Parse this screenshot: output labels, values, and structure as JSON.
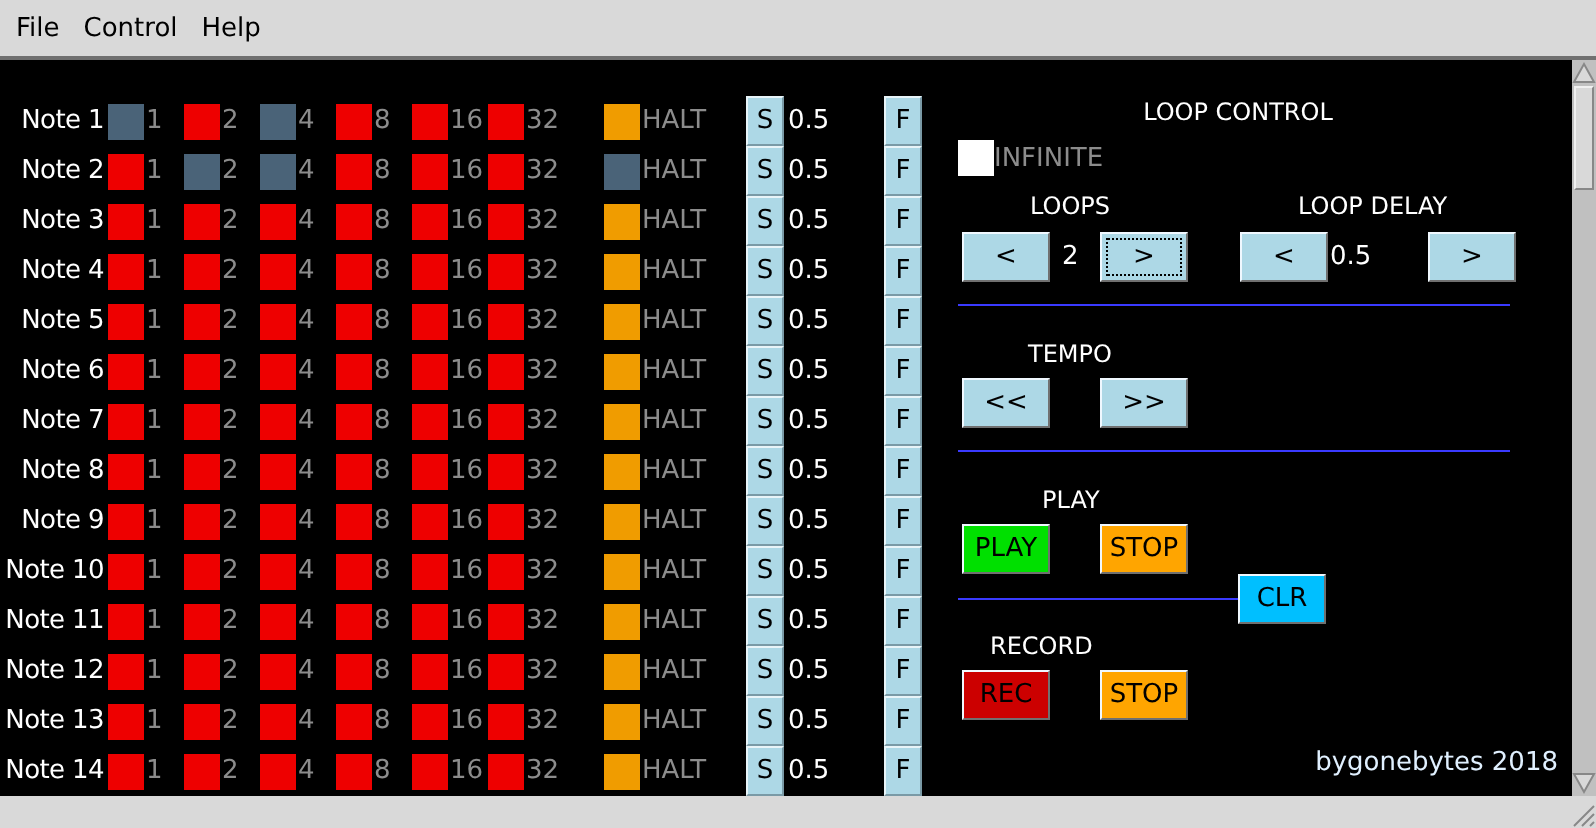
{
  "menu": [
    {
      "label": "File"
    },
    {
      "label": "Control"
    },
    {
      "label": "Help"
    }
  ],
  "notes": [
    {
      "label": "Note 1",
      "beats": [
        {
          "label": "1",
          "on": false
        },
        {
          "label": "2",
          "on": true
        },
        {
          "label": "4",
          "on": false
        },
        {
          "label": "8",
          "on": true
        },
        {
          "label": "16",
          "on": true
        },
        {
          "label": "32",
          "on": true
        }
      ],
      "halt": {
        "label": "HALT",
        "on": true
      },
      "s": "S",
      "value": "0.5",
      "f": "F"
    },
    {
      "label": "Note 2",
      "beats": [
        {
          "label": "1",
          "on": true
        },
        {
          "label": "2",
          "on": false
        },
        {
          "label": "4",
          "on": false
        },
        {
          "label": "8",
          "on": true
        },
        {
          "label": "16",
          "on": true
        },
        {
          "label": "32",
          "on": true
        }
      ],
      "halt": {
        "label": "HALT",
        "on": false
      },
      "s": "S",
      "value": "0.5",
      "f": "F"
    },
    {
      "label": "Note 3",
      "beats": [
        {
          "label": "1",
          "on": true
        },
        {
          "label": "2",
          "on": true
        },
        {
          "label": "4",
          "on": true
        },
        {
          "label": "8",
          "on": true
        },
        {
          "label": "16",
          "on": true
        },
        {
          "label": "32",
          "on": true
        }
      ],
      "halt": {
        "label": "HALT",
        "on": true
      },
      "s": "S",
      "value": "0.5",
      "f": "F"
    },
    {
      "label": "Note 4",
      "beats": [
        {
          "label": "1",
          "on": true
        },
        {
          "label": "2",
          "on": true
        },
        {
          "label": "4",
          "on": true
        },
        {
          "label": "8",
          "on": true
        },
        {
          "label": "16",
          "on": true
        },
        {
          "label": "32",
          "on": true
        }
      ],
      "halt": {
        "label": "HALT",
        "on": true
      },
      "s": "S",
      "value": "0.5",
      "f": "F"
    },
    {
      "label": "Note 5",
      "beats": [
        {
          "label": "1",
          "on": true
        },
        {
          "label": "2",
          "on": true
        },
        {
          "label": "4",
          "on": true
        },
        {
          "label": "8",
          "on": true
        },
        {
          "label": "16",
          "on": true
        },
        {
          "label": "32",
          "on": true
        }
      ],
      "halt": {
        "label": "HALT",
        "on": true
      },
      "s": "S",
      "value": "0.5",
      "f": "F"
    },
    {
      "label": "Note 6",
      "beats": [
        {
          "label": "1",
          "on": true
        },
        {
          "label": "2",
          "on": true
        },
        {
          "label": "4",
          "on": true
        },
        {
          "label": "8",
          "on": true
        },
        {
          "label": "16",
          "on": true
        },
        {
          "label": "32",
          "on": true
        }
      ],
      "halt": {
        "label": "HALT",
        "on": true
      },
      "s": "S",
      "value": "0.5",
      "f": "F"
    },
    {
      "label": "Note 7",
      "beats": [
        {
          "label": "1",
          "on": true
        },
        {
          "label": "2",
          "on": true
        },
        {
          "label": "4",
          "on": true
        },
        {
          "label": "8",
          "on": true
        },
        {
          "label": "16",
          "on": true
        },
        {
          "label": "32",
          "on": true
        }
      ],
      "halt": {
        "label": "HALT",
        "on": true
      },
      "s": "S",
      "value": "0.5",
      "f": "F"
    },
    {
      "label": "Note 8",
      "beats": [
        {
          "label": "1",
          "on": true
        },
        {
          "label": "2",
          "on": true
        },
        {
          "label": "4",
          "on": true
        },
        {
          "label": "8",
          "on": true
        },
        {
          "label": "16",
          "on": true
        },
        {
          "label": "32",
          "on": true
        }
      ],
      "halt": {
        "label": "HALT",
        "on": true
      },
      "s": "S",
      "value": "0.5",
      "f": "F"
    },
    {
      "label": "Note 9",
      "beats": [
        {
          "label": "1",
          "on": true
        },
        {
          "label": "2",
          "on": true
        },
        {
          "label": "4",
          "on": true
        },
        {
          "label": "8",
          "on": true
        },
        {
          "label": "16",
          "on": true
        },
        {
          "label": "32",
          "on": true
        }
      ],
      "halt": {
        "label": "HALT",
        "on": true
      },
      "s": "S",
      "value": "0.5",
      "f": "F"
    },
    {
      "label": "Note 10",
      "beats": [
        {
          "label": "1",
          "on": true
        },
        {
          "label": "2",
          "on": true
        },
        {
          "label": "4",
          "on": true
        },
        {
          "label": "8",
          "on": true
        },
        {
          "label": "16",
          "on": true
        },
        {
          "label": "32",
          "on": true
        }
      ],
      "halt": {
        "label": "HALT",
        "on": true
      },
      "s": "S",
      "value": "0.5",
      "f": "F"
    },
    {
      "label": "Note 11",
      "beats": [
        {
          "label": "1",
          "on": true
        },
        {
          "label": "2",
          "on": true
        },
        {
          "label": "4",
          "on": true
        },
        {
          "label": "8",
          "on": true
        },
        {
          "label": "16",
          "on": true
        },
        {
          "label": "32",
          "on": true
        }
      ],
      "halt": {
        "label": "HALT",
        "on": true
      },
      "s": "S",
      "value": "0.5",
      "f": "F"
    },
    {
      "label": "Note 12",
      "beats": [
        {
          "label": "1",
          "on": true
        },
        {
          "label": "2",
          "on": true
        },
        {
          "label": "4",
          "on": true
        },
        {
          "label": "8",
          "on": true
        },
        {
          "label": "16",
          "on": true
        },
        {
          "label": "32",
          "on": true
        }
      ],
      "halt": {
        "label": "HALT",
        "on": true
      },
      "s": "S",
      "value": "0.5",
      "f": "F"
    },
    {
      "label": "Note 13",
      "beats": [
        {
          "label": "1",
          "on": true
        },
        {
          "label": "2",
          "on": true
        },
        {
          "label": "4",
          "on": true
        },
        {
          "label": "8",
          "on": true
        },
        {
          "label": "16",
          "on": true
        },
        {
          "label": "32",
          "on": true
        }
      ],
      "halt": {
        "label": "HALT",
        "on": true
      },
      "s": "S",
      "value": "0.5",
      "f": "F"
    },
    {
      "label": "Note 14",
      "beats": [
        {
          "label": "1",
          "on": true
        },
        {
          "label": "2",
          "on": true
        },
        {
          "label": "4",
          "on": true
        },
        {
          "label": "8",
          "on": true
        },
        {
          "label": "16",
          "on": true
        },
        {
          "label": "32",
          "on": true
        }
      ],
      "halt": {
        "label": "HALT",
        "on": true
      },
      "s": "S",
      "value": "0.5",
      "f": "F"
    }
  ],
  "loop_control": {
    "title": "LOOP CONTROL",
    "infinite": {
      "label": "INFINITE",
      "checked": false
    },
    "loops": {
      "label": "LOOPS",
      "value": "2",
      "buttons": [
        {
          "label": "<",
          "focused": false
        },
        {
          "label": ">",
          "focused": true
        }
      ]
    },
    "loop_delay": {
      "label": "LOOP DELAY",
      "value": "0.5",
      "buttons": [
        {
          "label": "<",
          "focused": false
        },
        {
          "label": ">",
          "focused": false
        }
      ]
    }
  },
  "tempo": {
    "label": "TEMPO",
    "buttons": [
      {
        "label": "<<"
      },
      {
        "label": ">>"
      }
    ]
  },
  "play": {
    "label": "PLAY",
    "buttons": [
      {
        "label": "PLAY",
        "color": "#00e000"
      },
      {
        "label": "STOP",
        "color": "#ffa500"
      }
    ]
  },
  "clear": "CLR",
  "record": {
    "label": "RECORD",
    "buttons": [
      {
        "label": "REC",
        "color": "#cc0000"
      },
      {
        "label": "STOP",
        "color": "#ffa500"
      }
    ]
  },
  "credit": "bygonebytes 2018"
}
